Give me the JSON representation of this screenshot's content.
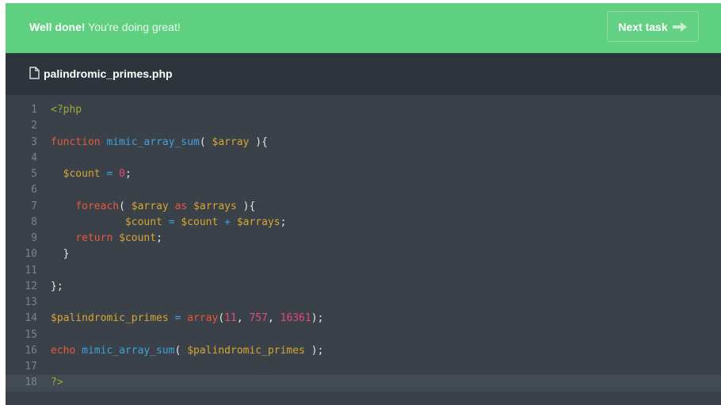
{
  "banner": {
    "strong": "Well done!",
    "rest": " You're doing great!",
    "button_label": "Next task",
    "color": "#5fcf80"
  },
  "file": {
    "icon": "file-icon",
    "name": "palindromic_primes.php"
  },
  "code": {
    "active_line": 18,
    "lines": [
      {
        "n": "1",
        "tokens": [
          {
            "t": "<?php",
            "c": "tag"
          }
        ]
      },
      {
        "n": "2",
        "tokens": []
      },
      {
        "n": "3",
        "tokens": [
          {
            "t": "function",
            "c": "kw"
          },
          {
            "t": " ",
            "c": "pun"
          },
          {
            "t": "mimic_array_sum",
            "c": "fn"
          },
          {
            "t": "( ",
            "c": "pun"
          },
          {
            "t": "$array",
            "c": "var"
          },
          {
            "t": " ){",
            "c": "pun"
          }
        ]
      },
      {
        "n": "4",
        "tokens": []
      },
      {
        "n": "5",
        "tokens": [
          {
            "t": "  ",
            "c": "pun"
          },
          {
            "t": "$count",
            "c": "var"
          },
          {
            "t": " ",
            "c": "pun"
          },
          {
            "t": "=",
            "c": "op"
          },
          {
            "t": " ",
            "c": "pun"
          },
          {
            "t": "0",
            "c": "num"
          },
          {
            "t": ";",
            "c": "pun"
          }
        ]
      },
      {
        "n": "6",
        "tokens": []
      },
      {
        "n": "7",
        "tokens": [
          {
            "t": "    ",
            "c": "pun"
          },
          {
            "t": "foreach",
            "c": "kw"
          },
          {
            "t": "( ",
            "c": "pun"
          },
          {
            "t": "$array",
            "c": "var"
          },
          {
            "t": " ",
            "c": "pun"
          },
          {
            "t": "as",
            "c": "kw"
          },
          {
            "t": " ",
            "c": "pun"
          },
          {
            "t": "$arrays",
            "c": "var"
          },
          {
            "t": " ){",
            "c": "pun"
          }
        ]
      },
      {
        "n": "8",
        "tokens": [
          {
            "t": "            ",
            "c": "pun"
          },
          {
            "t": "$count",
            "c": "var"
          },
          {
            "t": " ",
            "c": "pun"
          },
          {
            "t": "=",
            "c": "op"
          },
          {
            "t": " ",
            "c": "pun"
          },
          {
            "t": "$count",
            "c": "var"
          },
          {
            "t": " ",
            "c": "pun"
          },
          {
            "t": "+",
            "c": "op"
          },
          {
            "t": " ",
            "c": "pun"
          },
          {
            "t": "$arrays",
            "c": "var"
          },
          {
            "t": ";",
            "c": "pun"
          }
        ]
      },
      {
        "n": "9",
        "tokens": [
          {
            "t": "    ",
            "c": "pun"
          },
          {
            "t": "return",
            "c": "kw"
          },
          {
            "t": " ",
            "c": "pun"
          },
          {
            "t": "$count",
            "c": "var"
          },
          {
            "t": ";",
            "c": "pun"
          }
        ]
      },
      {
        "n": "10",
        "tokens": [
          {
            "t": "  }",
            "c": "pun"
          }
        ]
      },
      {
        "n": "11",
        "tokens": []
      },
      {
        "n": "12",
        "tokens": [
          {
            "t": "};",
            "c": "pun"
          }
        ]
      },
      {
        "n": "13",
        "tokens": []
      },
      {
        "n": "14",
        "tokens": [
          {
            "t": "$palindromic_primes",
            "c": "var"
          },
          {
            "t": " ",
            "c": "pun"
          },
          {
            "t": "=",
            "c": "op"
          },
          {
            "t": " ",
            "c": "pun"
          },
          {
            "t": "array",
            "c": "kw"
          },
          {
            "t": "(",
            "c": "pun"
          },
          {
            "t": "11",
            "c": "num"
          },
          {
            "t": ", ",
            "c": "pun"
          },
          {
            "t": "757",
            "c": "num"
          },
          {
            "t": ", ",
            "c": "pun"
          },
          {
            "t": "16361",
            "c": "num"
          },
          {
            "t": ");",
            "c": "pun"
          }
        ]
      },
      {
        "n": "15",
        "tokens": []
      },
      {
        "n": "16",
        "tokens": [
          {
            "t": "echo",
            "c": "kw"
          },
          {
            "t": " ",
            "c": "pun"
          },
          {
            "t": "mimic_array_sum",
            "c": "fn"
          },
          {
            "t": "( ",
            "c": "pun"
          },
          {
            "t": "$palindromic_primes",
            "c": "var"
          },
          {
            "t": " );",
            "c": "pun"
          }
        ]
      },
      {
        "n": "17",
        "tokens": []
      },
      {
        "n": "18",
        "tokens": [
          {
            "t": "?>",
            "c": "tag"
          }
        ]
      }
    ]
  }
}
